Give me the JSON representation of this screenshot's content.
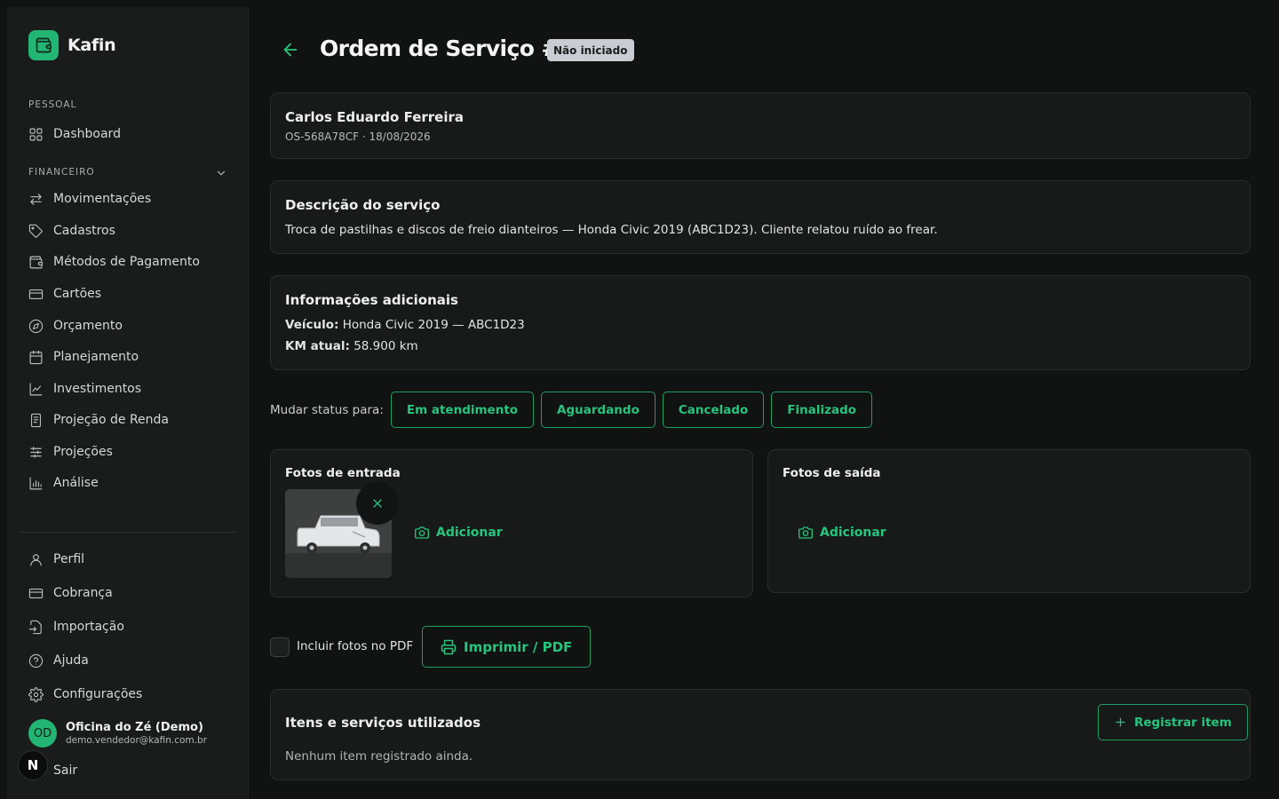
{
  "brand": {
    "name": "Kafin"
  },
  "sidebar": {
    "section_personal": "PESSOAL",
    "section_financeiro": "FINANCEIRO",
    "personal_items": [
      {
        "label": "Dashboard",
        "icon": "grid-icon"
      }
    ],
    "finance_items": [
      {
        "label": "Movimentações",
        "icon": "arrows-swap-icon"
      },
      {
        "label": "Cadastros",
        "icon": "tag-icon"
      },
      {
        "label": "Métodos de Pagamento",
        "icon": "wallet-icon"
      },
      {
        "label": "Cartões",
        "icon": "credit-card-icon"
      },
      {
        "label": "Orçamento",
        "icon": "compass-icon"
      },
      {
        "label": "Planejamento",
        "icon": "calendar-icon"
      },
      {
        "label": "Investimentos",
        "icon": "trend-icon"
      },
      {
        "label": "Projeção de Renda",
        "icon": "receipt-icon"
      },
      {
        "label": "Projeções",
        "icon": "sliders-icon"
      },
      {
        "label": "Análise",
        "icon": "bar-chart-icon"
      }
    ],
    "bottom_items": [
      {
        "label": "Perfil",
        "icon": "user-icon"
      },
      {
        "label": "Cobrança",
        "icon": "credit-card-icon"
      },
      {
        "label": "Importação",
        "icon": "import-icon"
      },
      {
        "label": "Ajuda",
        "icon": "help-icon"
      },
      {
        "label": "Configurações",
        "icon": "gear-icon"
      }
    ],
    "user": {
      "initials": "OD",
      "name": "Oficina do Zé (Demo)",
      "email": "demo.vendedor@kafin.com.br"
    },
    "n_badge": "N",
    "logout": "Sair"
  },
  "header": {
    "title": "Ordem de Serviço #3",
    "status": "Não iniciado"
  },
  "client": {
    "name": "Carlos Eduardo Ferreira",
    "meta": "OS-568A78CF · 18/08/2026"
  },
  "description": {
    "title": "Descrição do serviço",
    "text": "Troca de pastilhas e discos de freio dianteiros — Honda Civic 2019 (ABC1D23). Cliente relatou ruído ao frear."
  },
  "additional": {
    "title": "Informações adicionais",
    "vehicle_label": "Veículo:",
    "vehicle_value": "Honda Civic 2019 — ABC1D23",
    "km_label": "KM atual:",
    "km_value": "58.900 km"
  },
  "status_change": {
    "label": "Mudar status para:",
    "options": [
      "Em atendimento",
      "Aguardando",
      "Cancelado",
      "Finalizado"
    ]
  },
  "photos": {
    "entry_title": "Fotos de entrada",
    "exit_title": "Fotos de saída",
    "add_label": "Adicionar"
  },
  "pdf": {
    "include_photos_label": "Incluir fotos no PDF",
    "print_label": "Imprimir / PDF"
  },
  "items": {
    "title": "Itens e serviços utilizados",
    "register_label": "Registrar item",
    "empty_text": "Nenhum item registrado ainda."
  },
  "colors": {
    "accent": "#26c47c",
    "brand": "#22b573",
    "background": "#111312",
    "card": "#181a19",
    "badge": "#c9ccd2"
  }
}
